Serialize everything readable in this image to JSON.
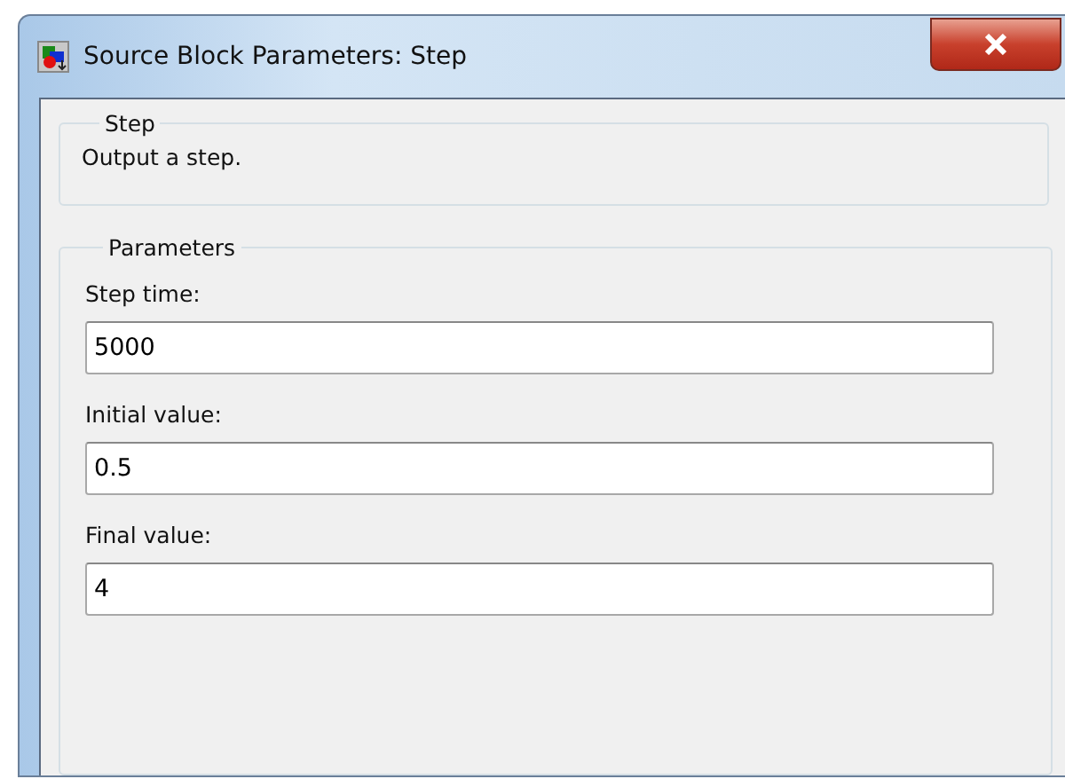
{
  "window": {
    "title": "Source Block Parameters: Step"
  },
  "description_group": {
    "legend": "Step",
    "text": "Output a step."
  },
  "parameters_group": {
    "legend": "Parameters",
    "fields": [
      {
        "label": "Step time:",
        "value": "5000"
      },
      {
        "label": "Initial value:",
        "value": "0.5"
      },
      {
        "label": "Final value:",
        "value": "4"
      }
    ]
  }
}
